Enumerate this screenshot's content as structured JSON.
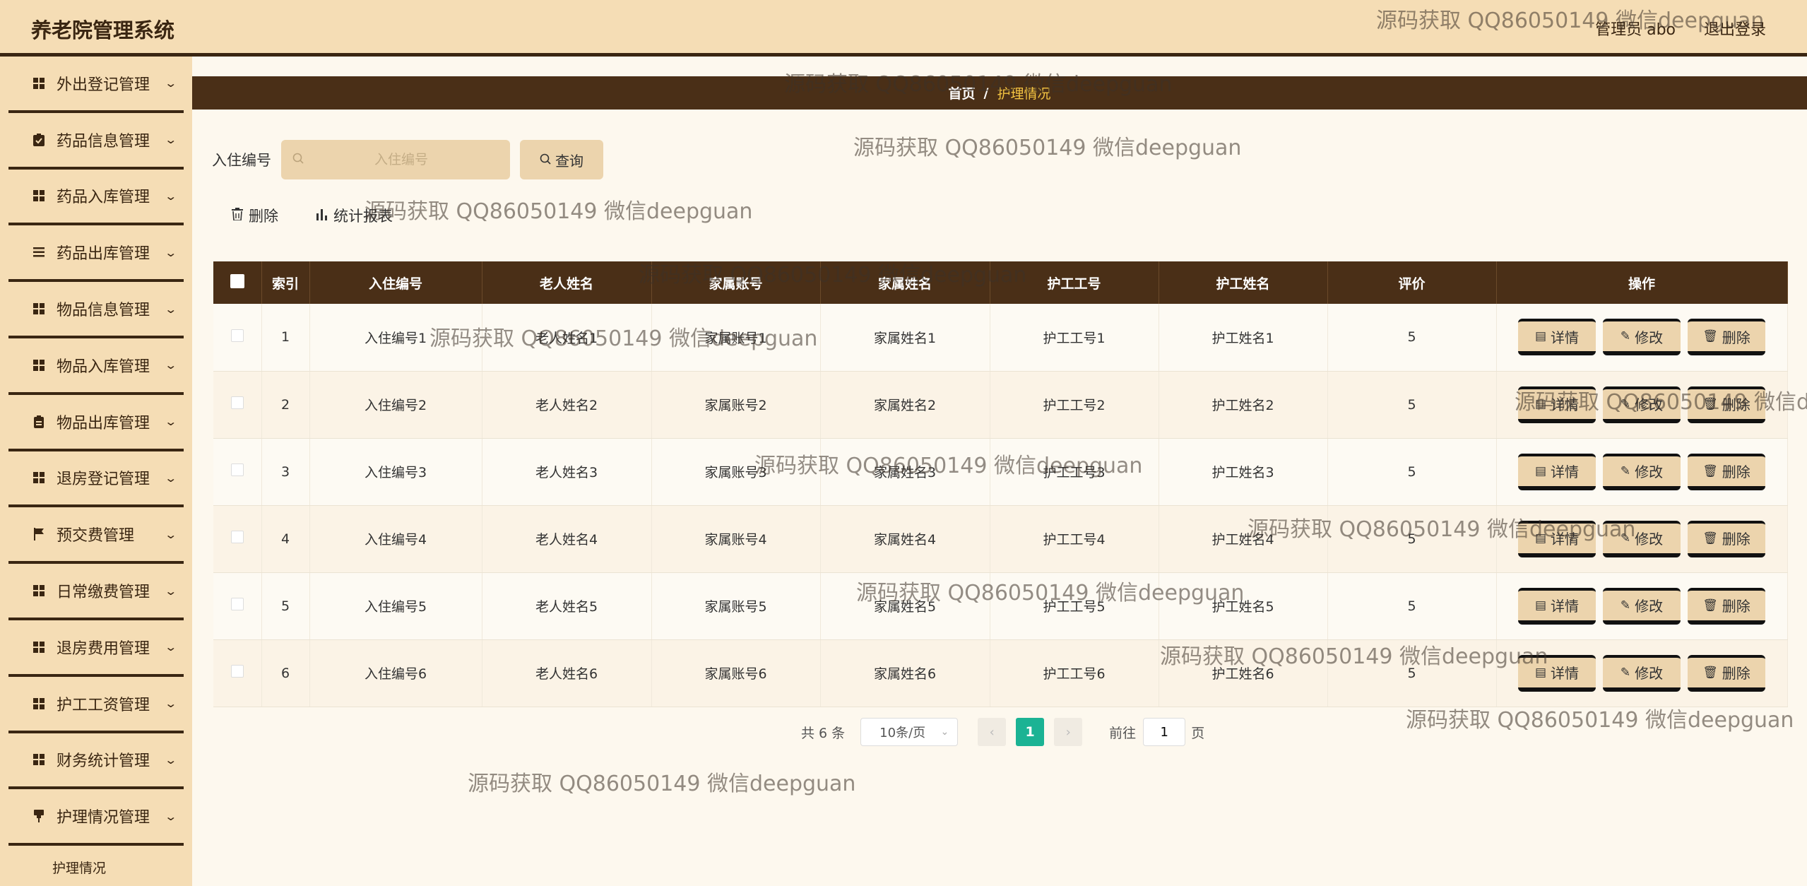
{
  "header": {
    "app_title": "养老院管理系统",
    "user_label": "管理员 abo",
    "logout_label": "退出登录"
  },
  "sidebar": {
    "items": [
      {
        "label": "外出登记管理",
        "icon": "grid-icon"
      },
      {
        "label": "药品信息管理",
        "icon": "clipboard-check-icon"
      },
      {
        "label": "药品入库管理",
        "icon": "grid-icon"
      },
      {
        "label": "药品出库管理",
        "icon": "list-icon"
      },
      {
        "label": "物品信息管理",
        "icon": "grid-icon"
      },
      {
        "label": "物品入库管理",
        "icon": "grid-icon"
      },
      {
        "label": "物品出库管理",
        "icon": "clipboard-icon"
      },
      {
        "label": "退房登记管理",
        "icon": "grid-icon"
      },
      {
        "label": "预交费管理",
        "icon": "flag-icon"
      },
      {
        "label": "日常缴费管理",
        "icon": "grid-icon"
      },
      {
        "label": "退房费用管理",
        "icon": "grid-icon"
      },
      {
        "label": "护工工资管理",
        "icon": "grid-icon"
      },
      {
        "label": "财务统计管理",
        "icon": "grid-icon"
      },
      {
        "label": "护理情况管理",
        "icon": "pin-icon"
      }
    ],
    "sub_item": "护理情况"
  },
  "breadcrumb": {
    "home": "首页",
    "separator": "/",
    "current": "护理情况"
  },
  "search": {
    "label": "入住编号",
    "placeholder": "入住编号",
    "value": "",
    "button_label": "查询"
  },
  "actions": {
    "delete_label": "删除",
    "report_label": "统计报表"
  },
  "table": {
    "headers": [
      "索引",
      "入住编号",
      "老人姓名",
      "家属账号",
      "家属姓名",
      "护工工号",
      "护工姓名",
      "评价",
      "操作"
    ],
    "rows": [
      {
        "index": "1",
        "checkin_no": "入住编号1",
        "elder_name": "老人姓名1",
        "family_account": "家属账号1",
        "family_name": "家属姓名1",
        "worker_no": "护工工号1",
        "worker_name": "护工姓名1",
        "rating": "5"
      },
      {
        "index": "2",
        "checkin_no": "入住编号2",
        "elder_name": "老人姓名2",
        "family_account": "家属账号2",
        "family_name": "家属姓名2",
        "worker_no": "护工工号2",
        "worker_name": "护工姓名2",
        "rating": "5"
      },
      {
        "index": "3",
        "checkin_no": "入住编号3",
        "elder_name": "老人姓名3",
        "family_account": "家属账号3",
        "family_name": "家属姓名3",
        "worker_no": "护工工号3",
        "worker_name": "护工姓名3",
        "rating": "5"
      },
      {
        "index": "4",
        "checkin_no": "入住编号4",
        "elder_name": "老人姓名4",
        "family_account": "家属账号4",
        "family_name": "家属姓名4",
        "worker_no": "护工工号4",
        "worker_name": "护工姓名4",
        "rating": "5"
      },
      {
        "index": "5",
        "checkin_no": "入住编号5",
        "elder_name": "老人姓名5",
        "family_account": "家属账号5",
        "family_name": "家属姓名5",
        "worker_no": "护工工号5",
        "worker_name": "护工姓名5",
        "rating": "5"
      },
      {
        "index": "6",
        "checkin_no": "入住编号6",
        "elder_name": "老人姓名6",
        "family_account": "家属账号6",
        "family_name": "家属姓名6",
        "worker_no": "护工工号6",
        "worker_name": "护工姓名6",
        "rating": "5"
      }
    ],
    "row_actions": {
      "detail": "详情",
      "edit": "修改",
      "delete": "删除"
    }
  },
  "pagination": {
    "total_text": "共 6 条",
    "page_size": "10条/页",
    "current_page": "1",
    "goto_label": "前往",
    "goto_value": "1",
    "page_unit": "页"
  },
  "watermark": {
    "text": "源码获取 QQ86050149 微信deepguan"
  },
  "colors": {
    "primary_dark": "#4a2f17",
    "sidebar_bg": "#f5ddb5",
    "button_bg": "#ecd4ad",
    "page_active": "#1bb394",
    "breadcrumb_current": "#f5c542"
  }
}
